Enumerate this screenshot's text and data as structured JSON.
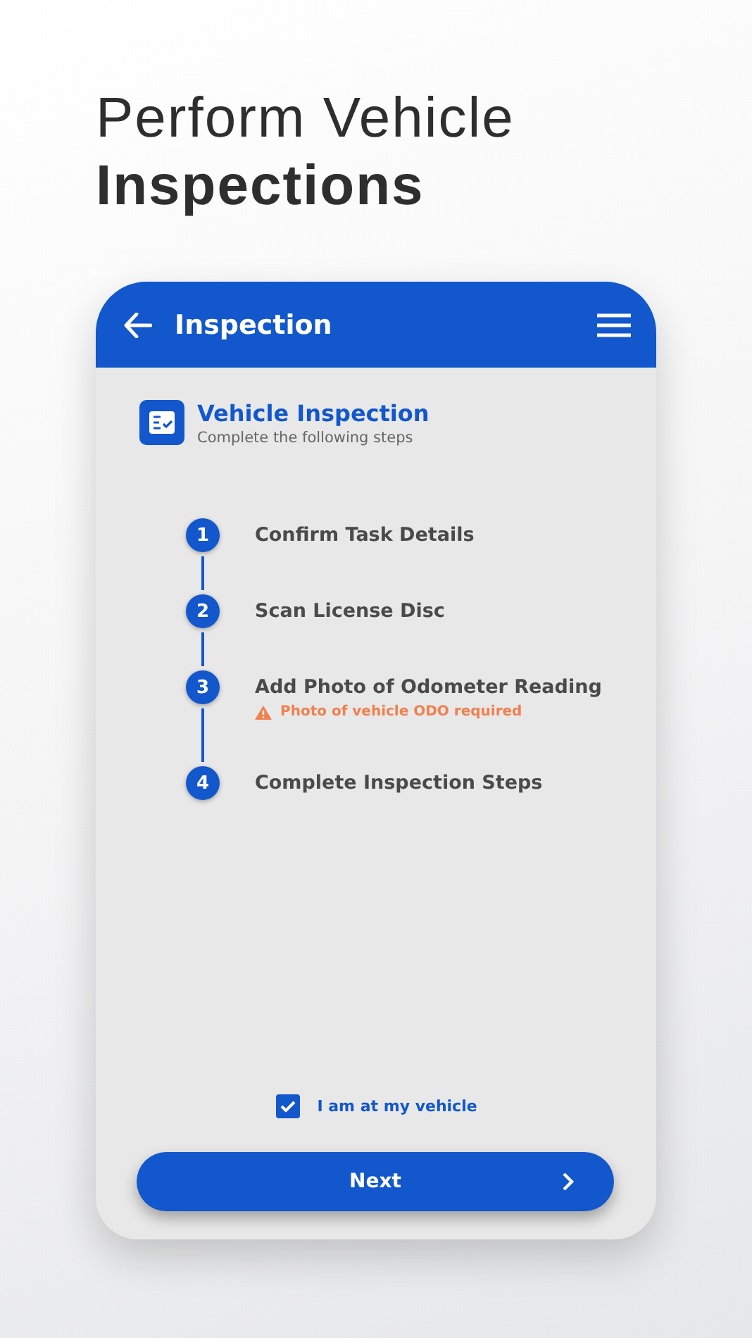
{
  "headline": {
    "line_1": "Perform Vehicle",
    "line_2": "Inspections"
  },
  "app_bar": {
    "title": "Inspection"
  },
  "section": {
    "title": "Vehicle Inspection",
    "subtitle": "Complete the following steps"
  },
  "steps": [
    {
      "number": "1",
      "label": "Confirm Task Details"
    },
    {
      "number": "2",
      "label": "Scan License Disc"
    },
    {
      "number": "3",
      "label": "Add Photo of Odometer Reading",
      "warning": "Photo of vehicle ODO required"
    },
    {
      "number": "4",
      "label": "Complete Inspection Steps"
    }
  ],
  "confirm": {
    "label": "I am at my vehicle",
    "checked": true
  },
  "next_button": {
    "label": "Next"
  }
}
